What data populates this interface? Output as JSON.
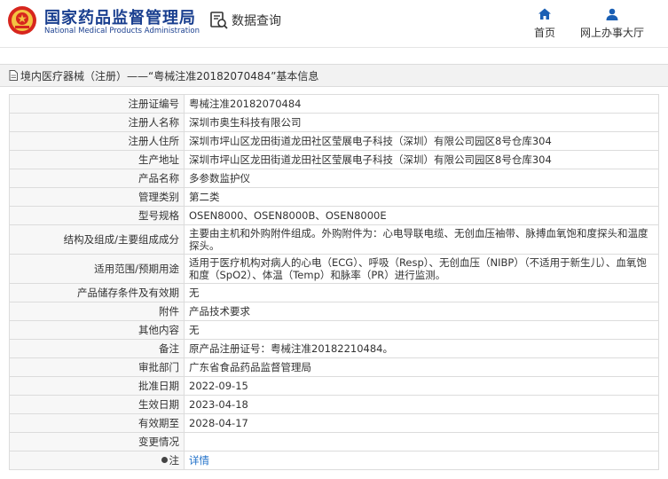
{
  "header": {
    "org_cn": "国家药品监督管理局",
    "org_en": "National Medical Products Administration",
    "query_label": "数据查询",
    "home_label": "首页",
    "online_label": "网上办事大厅",
    "brand_color": "#1a3f8f",
    "seal_color": "#d7261e",
    "icon_color": "#1a5fb4"
  },
  "section": {
    "title": "境内医疗器械（注册）——“粤械注准20182070484”基本信息"
  },
  "fields": [
    {
      "key": "注册证编号",
      "value": "粤械注准20182070484"
    },
    {
      "key": "注册人名称",
      "value": "深圳市奥生科技有限公司"
    },
    {
      "key": "注册人住所",
      "value": "深圳市坪山区龙田街道龙田社区莹展电子科技（深圳）有限公司园区8号仓库304"
    },
    {
      "key": "生产地址",
      "value": "深圳市坪山区龙田街道龙田社区莹展电子科技（深圳）有限公司园区8号仓库304"
    },
    {
      "key": "产品名称",
      "value": "多参数监护仪"
    },
    {
      "key": "管理类别",
      "value": "第二类"
    },
    {
      "key": "型号规格",
      "value": "OSEN8000、OSEN8000B、OSEN8000E"
    },
    {
      "key": "结构及组成/主要组成成分",
      "value": "主要由主机和外购附件组成。外购附件为：心电导联电缆、无创血压袖带、脉搏血氧饱和度探头和温度探头。"
    },
    {
      "key": "适用范围/预期用途",
      "value": "适用于医疗机构对病人的心电（ECG）、呼吸（Resp）、无创血压（NIBP）（不适用于新生儿）、血氧饱和度（SpO2）、体温（Temp）和脉率（PR）进行监测。"
    },
    {
      "key": "产品储存条件及有效期",
      "value": "无"
    },
    {
      "key": "附件",
      "value": "产品技术要求"
    },
    {
      "key": "其他内容",
      "value": "无"
    },
    {
      "key": "备注",
      "value": "原产品注册证号：粤械注准20182210484。"
    },
    {
      "key": "审批部门",
      "value": "广东省食品药品监督管理局"
    },
    {
      "key": "批准日期",
      "value": "2022-09-15"
    },
    {
      "key": "生效日期",
      "value": "2023-04-18"
    },
    {
      "key": "有效期至",
      "value": "2028-04-17"
    },
    {
      "key": "变更情况",
      "value": ""
    }
  ],
  "note": {
    "key": "注",
    "link_label": "详情"
  }
}
